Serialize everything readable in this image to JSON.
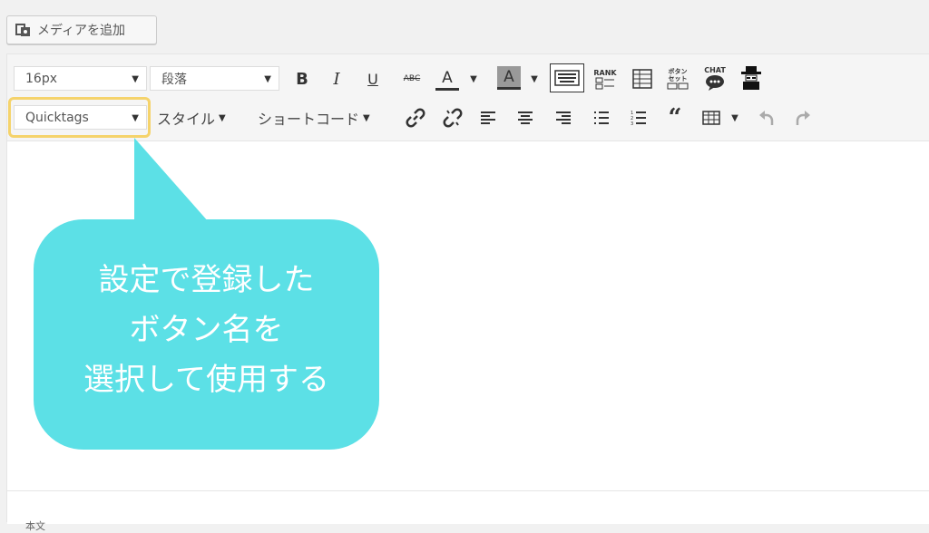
{
  "media_button": {
    "label": "メディアを追加",
    "icon": "media-icon"
  },
  "toolbar": {
    "font_size": "16px",
    "paragraph": "段落",
    "format_select": "Quicktags",
    "style_label": "スタイル",
    "shortcode_label": "ショートコード",
    "bold": "B",
    "italic": "I",
    "underline": "U",
    "strike": "ABC",
    "text_color": "A",
    "bg_color": "A",
    "rank_label": "RANK",
    "button_set_label": "ボタン\nセット",
    "chat_label": "CHAT"
  },
  "callout": {
    "line1": "設定で登録した",
    "line2": "ボタン名を",
    "line3": "選択して使用する",
    "color": "#5ce0e6"
  },
  "status": {
    "text": "本文"
  },
  "colors": {
    "highlight": "#f5d36b",
    "bubble": "#5ce0e6"
  }
}
